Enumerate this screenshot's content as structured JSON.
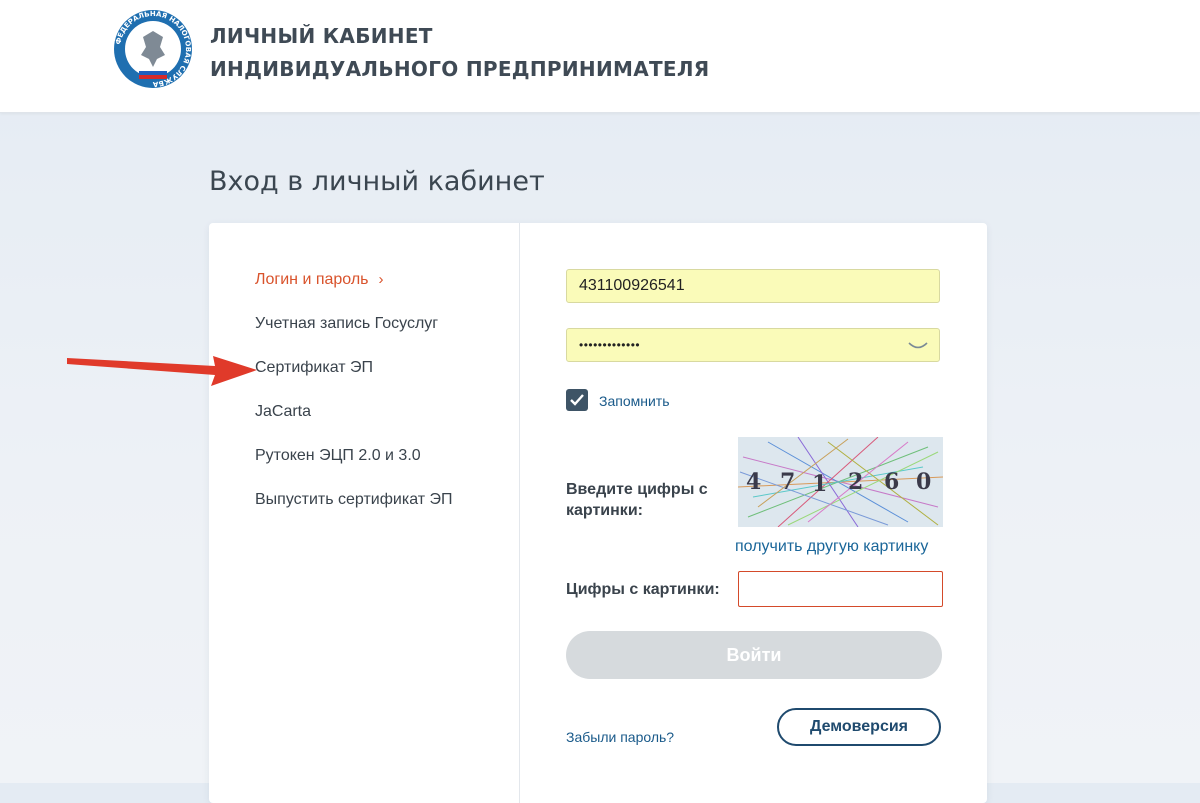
{
  "header": {
    "title_line1": "ЛИЧНЫЙ КАБИНЕТ",
    "title_line2": "ИНДИВИДУАЛЬНОГО ПРЕДПРИНИМАТЕЛЯ",
    "logo_text": "ФЕДЕРАЛЬНАЯ НАЛОГОВАЯ СЛУЖБА"
  },
  "page": {
    "title": "Вход в личный кабинет"
  },
  "methods": [
    {
      "label": "Логин и пароль",
      "active": true
    },
    {
      "label": "Учетная запись Госуслуг",
      "active": false
    },
    {
      "label": "Сертификат ЭП",
      "active": false
    },
    {
      "label": "JaCarta",
      "active": false
    },
    {
      "label": "Рутокен ЭЦП 2.0 и 3.0",
      "active": false
    },
    {
      "label": "Выпустить сертификат ЭП",
      "active": false
    }
  ],
  "form": {
    "login_value": "431100926541",
    "password_value": "•••••••••••••",
    "remember_label": "Запомнить",
    "remember_checked": true,
    "captcha_prompt": "Введите цифры с картинки:",
    "captcha_digits": "471260",
    "captcha_refresh": "получить другую картинку",
    "digits_label": "Цифры с картинки:",
    "submit_label": "Войти",
    "forgot_label": "Забыли пароль?",
    "demo_label": "Демоверсия"
  },
  "colors": {
    "active_method": "#d9532c",
    "link": "#1a5a8a",
    "autofill_bg": "#fafbb9",
    "arrow": "#e03a2a"
  }
}
